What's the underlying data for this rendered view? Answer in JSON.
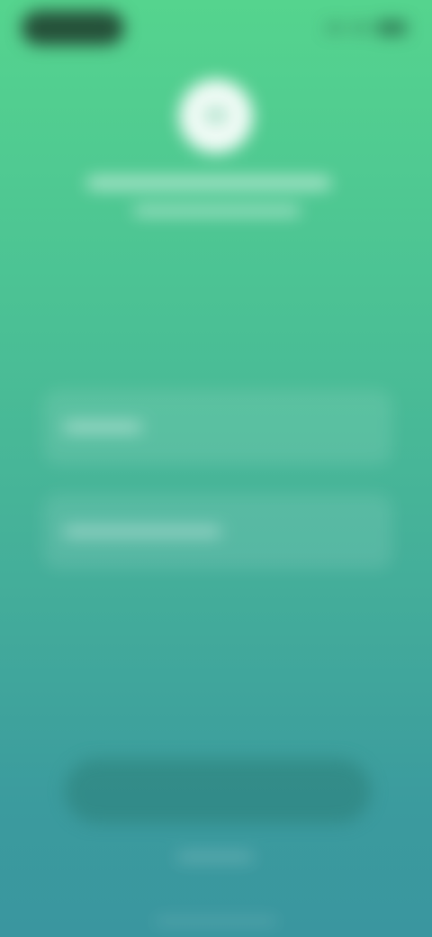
{
  "app": {
    "title": "",
    "subtitle": ""
  },
  "status_bar": {
    "time": ""
  },
  "form": {
    "email_placeholder": "",
    "password_placeholder": ""
  },
  "actions": {
    "primary_label": "",
    "footer_link": ""
  },
  "colors": {
    "gradient_top": "#55D48E",
    "gradient_bottom": "#3A969F",
    "logo_bg": "#FFFFFF"
  },
  "icons": [
    "signal-icon",
    "wifi-icon",
    "battery-icon",
    "app-logo-icon"
  ]
}
